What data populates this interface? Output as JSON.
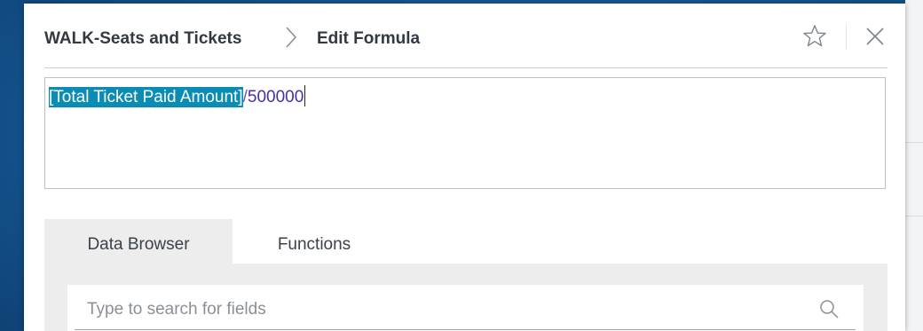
{
  "header": {
    "app_name": "WALK-Seats and Tickets",
    "page_title": "Edit Formula",
    "star_icon": "star-icon",
    "close_icon": "close-icon"
  },
  "formula": {
    "field_token": "[Total Ticket Paid Amount]",
    "operator": "/",
    "number": "500000"
  },
  "tabs": [
    {
      "label": "Data Browser",
      "active": true
    },
    {
      "label": "Functions",
      "active": false
    }
  ],
  "search": {
    "placeholder": "Type to search for fields",
    "value": "",
    "icon": "search-icon"
  },
  "colors": {
    "selection": "#0a8cb4",
    "number": "#4b2fa2",
    "tab_active_bg": "#ededed",
    "backdrop": "#165a96"
  }
}
